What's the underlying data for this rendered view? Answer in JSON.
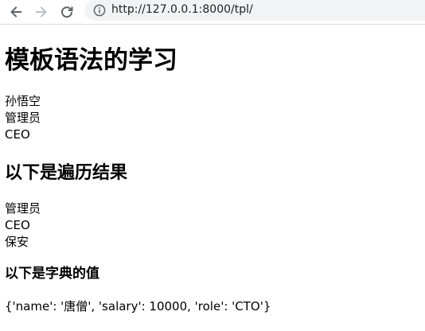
{
  "browser": {
    "url": "http://127.0.0.1:8000/tpl/",
    "back_icon": "back-arrow-icon",
    "forward_icon": "forward-arrow-icon",
    "reload_icon": "reload-icon",
    "info_icon": "info-icon"
  },
  "page": {
    "title": "模板语法的学习",
    "variables": [
      "孙悟空",
      "管理员",
      "CEO"
    ],
    "loop_heading": "以下是遍历结果",
    "loop_items": [
      "管理员",
      "CEO",
      "保安"
    ],
    "dict_heading": "以下是字典的值",
    "dict_value": "{'name': '唐僧', 'salary': 10000, 'role': 'CTO'}"
  }
}
